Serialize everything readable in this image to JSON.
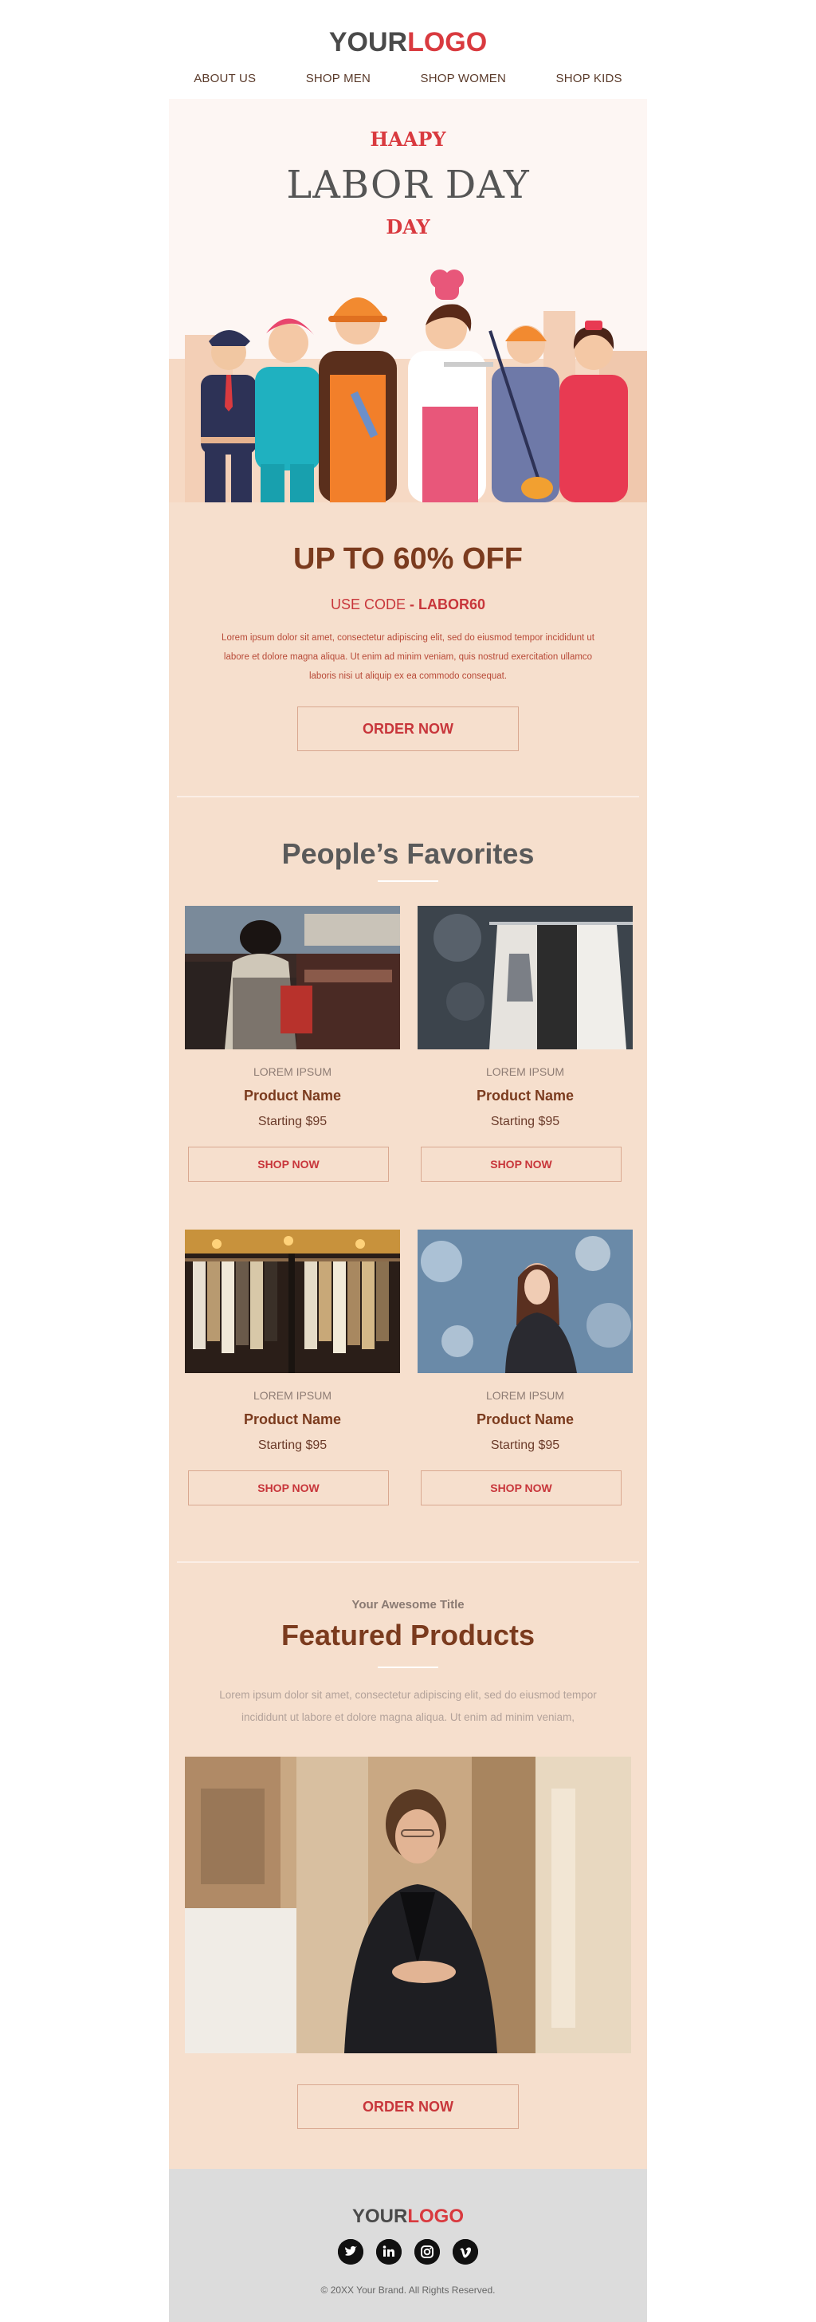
{
  "header": {
    "logo_part1": "YOUR",
    "logo_part2": "LOGO",
    "nav": [
      "ABOUT US",
      "SHOP MEN",
      "SHOP WOMEN",
      "SHOP KIDS"
    ]
  },
  "hero": {
    "line1": "HAAPY",
    "line2": "LABOR DAY",
    "line3": "DAY",
    "illustration_icon": "workers-illustration"
  },
  "offer": {
    "headline": "UP TO 60% OFF",
    "code_prefix": "USE CODE",
    "code_value": "- LABOR60",
    "body": "Lorem ipsum dolor sit amet, consectetur adipiscing elit, sed do eiusmod tempor incididunt ut labore et dolore magna aliqua. Ut enim ad minim veniam, quis nostrud exercitation ullamco laboris nisi ut aliquip ex ea commodo consequat.",
    "button": "ORDER NOW"
  },
  "favorites": {
    "title": "People’s Favorites",
    "products": [
      {
        "category": "LOREM IPSUM",
        "name": "Product Name",
        "price": "Starting $95",
        "button": "SHOP NOW"
      },
      {
        "category": "LOREM IPSUM",
        "name": "Product Name",
        "price": "Starting $95",
        "button": "SHOP NOW"
      },
      {
        "category": "LOREM IPSUM",
        "name": "Product Name",
        "price": "Starting $95",
        "button": "SHOP NOW"
      },
      {
        "category": "LOREM IPSUM",
        "name": "Product Name",
        "price": "Starting $95",
        "button": "SHOP NOW"
      }
    ]
  },
  "featured": {
    "eyebrow": "Your Awesome Title",
    "title": "Featured Products",
    "body": "Lorem ipsum dolor sit amet, consectetur adipiscing elit, sed do eiusmod tempor incididunt ut labore et dolore magna aliqua. Ut enim ad minim veniam,",
    "button": "ORDER NOW"
  },
  "footer": {
    "logo_part1": "YOUR",
    "logo_part2": "LOGO",
    "social_icons": [
      "twitter-icon",
      "linkedin-icon",
      "instagram-icon",
      "vimeo-icon"
    ],
    "copyright": "© 20XX Your Brand. All Rights Reserved."
  },
  "colors": {
    "accent_red": "#d93a3f",
    "brown": "#7b3b1e",
    "peach_bg": "#f6dfcd",
    "hero_bg": "#fdf6f3",
    "footer_bg": "#dcdcdc"
  }
}
